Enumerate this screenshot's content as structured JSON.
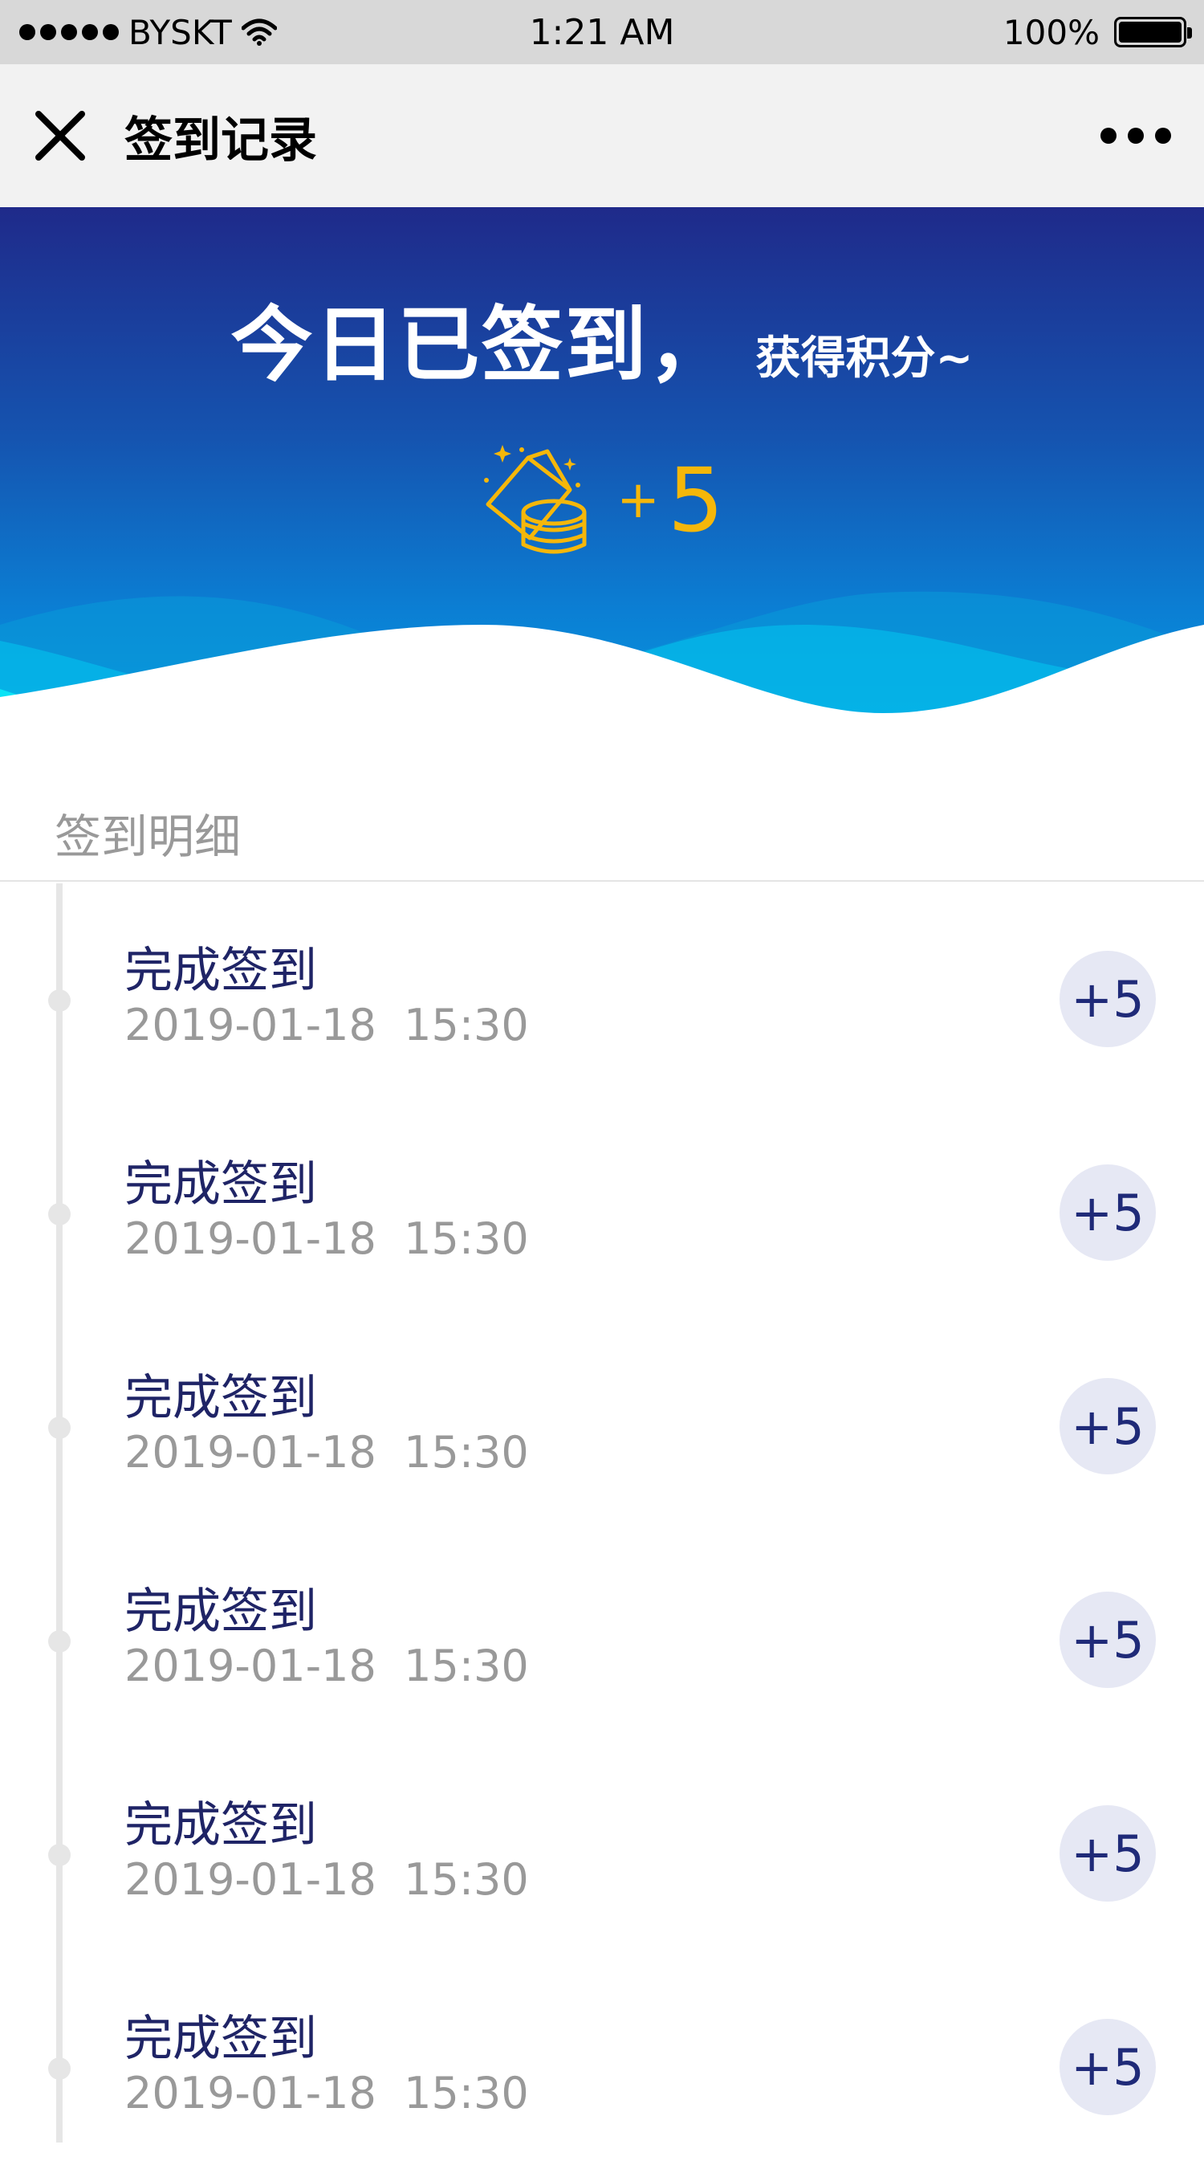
{
  "status_bar": {
    "carrier": "BYSKT",
    "time": "1:21 AM",
    "battery": "100%"
  },
  "nav": {
    "title": "签到记录"
  },
  "hero": {
    "heading": "今日已签到，",
    "subheading": "获得积分~",
    "points_plus": "+",
    "points_value": "5",
    "colors": {
      "gradient_top": "#1f2a8a",
      "gradient_bottom": "#03a6e4",
      "points": "#f5b70a"
    }
  },
  "section": {
    "title": "签到明细"
  },
  "records": [
    {
      "title": "完成签到",
      "datetime": "2019-01-18  15:30",
      "points": "+5"
    },
    {
      "title": "完成签到",
      "datetime": "2019-01-18  15:30",
      "points": "+5"
    },
    {
      "title": "完成签到",
      "datetime": "2019-01-18  15:30",
      "points": "+5"
    },
    {
      "title": "完成签到",
      "datetime": "2019-01-18  15:30",
      "points": "+5"
    },
    {
      "title": "完成签到",
      "datetime": "2019-01-18  15:30",
      "points": "+5"
    },
    {
      "title": "完成签到",
      "datetime": "2019-01-18  15:30",
      "points": "+5"
    }
  ],
  "icons": {
    "close": "close-icon",
    "more": "more-icon",
    "coins": "coins-card-icon",
    "wifi": "wifi-icon",
    "battery": "battery-icon"
  }
}
